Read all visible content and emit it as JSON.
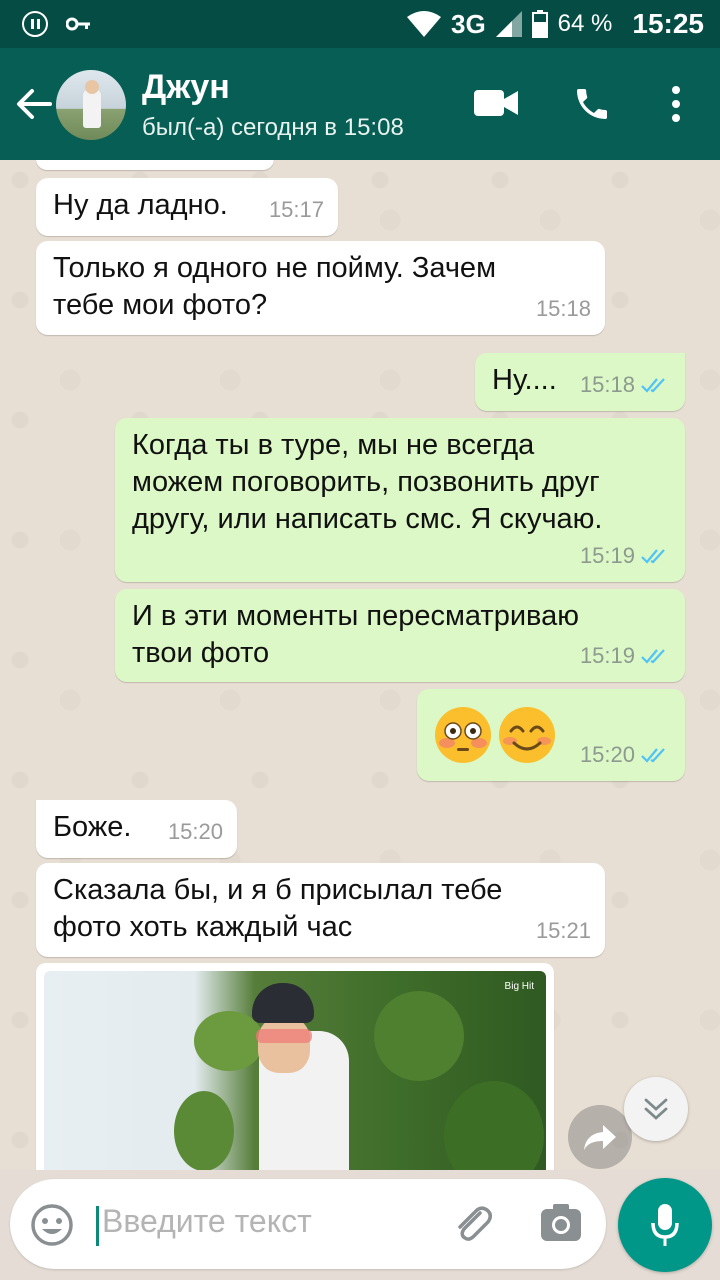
{
  "status_bar": {
    "network": "3G",
    "battery": "64 %",
    "time": "15:25"
  },
  "header": {
    "contact_name": "Джун",
    "last_seen": "был(-а) сегодня в 15:08"
  },
  "messages": [
    {
      "direction": "in",
      "text": "Ну да ладно.",
      "time": "15:17"
    },
    {
      "direction": "in",
      "text": "Только я одного не пойму. Зачем\nтебе мои фото?",
      "time": "15:18"
    },
    {
      "direction": "out",
      "text": "Ну....",
      "time": "15:18",
      "status": "read"
    },
    {
      "direction": "out",
      "text": "Когда ты в туре, мы не всегда\nможем поговорить, позвонить друг\nдругу, или написать смс. Я скучаю.",
      "time": "15:19",
      "status": "read"
    },
    {
      "direction": "out",
      "text": "И в эти моменты пересматриваю\nтвои фото",
      "time": "15:19",
      "status": "read"
    },
    {
      "direction": "out",
      "emoji": [
        "flushed-face",
        "smiling-face"
      ],
      "time": "15:20",
      "status": "read"
    },
    {
      "direction": "in",
      "text": "Боже.",
      "time": "15:20"
    },
    {
      "direction": "in",
      "text": "Сказала бы, и я б присылал тебе\nфото хоть каждый час",
      "time": "15:21"
    },
    {
      "direction": "in",
      "type": "photo",
      "watermark": "Big Hit"
    }
  ],
  "input": {
    "placeholder": "Введите текст"
  },
  "colors": {
    "header": "#075e54",
    "status_bar": "#054d44",
    "outgoing_bubble": "#dcf8c6",
    "incoming_bubble": "#ffffff",
    "read_ticks": "#4fc3f7",
    "mic_button": "#009688"
  },
  "icons": [
    "back-arrow-icon",
    "video-call-icon",
    "phone-icon",
    "more-vert-icon",
    "emoji-icon",
    "attach-icon",
    "camera-icon",
    "mic-icon",
    "scroll-down-icon",
    "forward-icon"
  ]
}
